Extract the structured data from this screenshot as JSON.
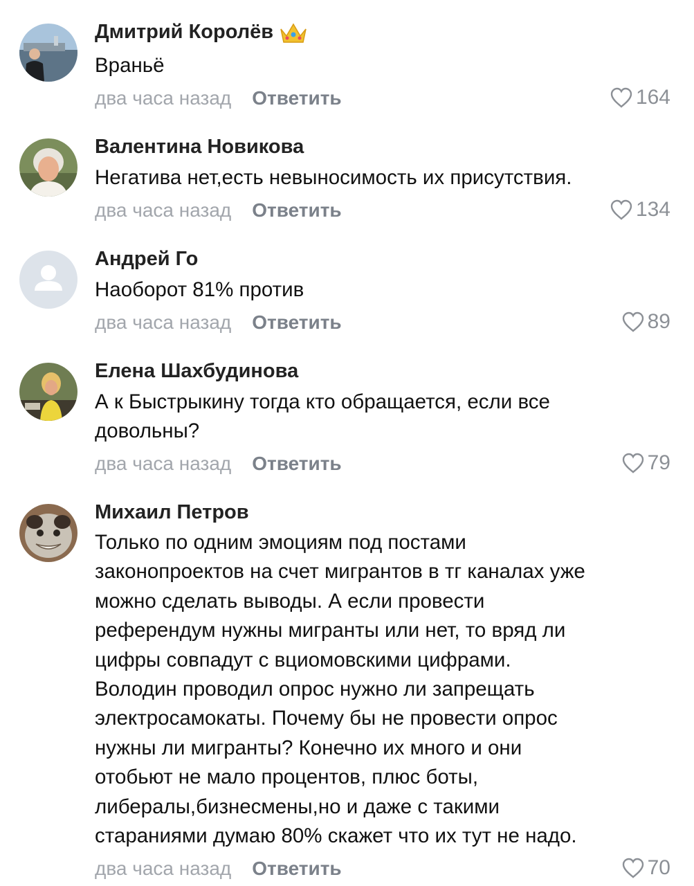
{
  "comments": [
    {
      "author": "Дмитрий Королёв",
      "badge_icon": "crown-icon",
      "lines": [
        "Враньё"
      ],
      "time": "два часа назад",
      "reply_label": "Ответить",
      "likes": "164"
    },
    {
      "author": "Валентина Новикова",
      "lines": [
        "Негатива нет,есть невыносимость их присутствия."
      ],
      "time": "два часа назад",
      "reply_label": "Ответить",
      "likes": "134"
    },
    {
      "author": "Андрей Го",
      "lines": [
        "Наоборот 81% против"
      ],
      "time": "два часа назад",
      "reply_label": "Ответить",
      "likes": "89"
    },
    {
      "author": "Елена Шахбудинова",
      "lines": [
        "А к Быстрыкину тогда кто обращается, если все",
        "довольны?"
      ],
      "time": "два часа назад",
      "reply_label": "Ответить",
      "likes": "79"
    },
    {
      "author": "Михаил Петров",
      "lines": [
        "Только по одним эмоциям под постами",
        "законопроектов на счет мигрантов в тг каналах уже",
        "можно сделать выводы. А если провести",
        "референдум нужны мигранты или нет, то вряд ли",
        "цифры совпадут с вциомовскими цифрами.",
        "Володин проводил опрос нужно ли запрещать",
        "электросамокаты. Почему бы не провести опрос",
        "нужны ли мигранты? Конечно их много и они",
        "отобьют не мало процентов, плюс боты,",
        "либералы,бизнесмены,но и даже с такими",
        "стараниями думаю 80% скажет что их тут не надо."
      ],
      "time": "два часа назад",
      "reply_label": "Ответить",
      "likes": "70"
    }
  ],
  "colors": {
    "meta": "#a2a6ac",
    "reply": "#7b818a",
    "likes": "#8c9096"
  }
}
